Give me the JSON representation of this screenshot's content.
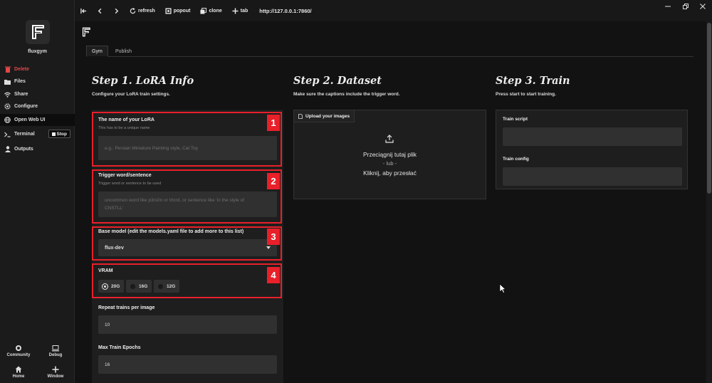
{
  "sidebar": {
    "app_name": "fluxgym",
    "items": [
      {
        "label": "Delete",
        "icon": "trash-icon"
      },
      {
        "label": "Files",
        "icon": "folder-icon"
      },
      {
        "label": "Share",
        "icon": "wifi-icon"
      },
      {
        "label": "Configure",
        "icon": "gear-icon"
      },
      {
        "label": "Open Web UI",
        "icon": "globe-icon"
      },
      {
        "label": "Terminal",
        "icon": "terminal-icon"
      },
      {
        "label": "Outputs",
        "icon": "user-icon"
      }
    ],
    "stop_label": "Stop",
    "bottom": [
      {
        "label": "Community",
        "icon": "community-icon"
      },
      {
        "label": "Debug",
        "icon": "monitor-icon"
      },
      {
        "label": "Home",
        "icon": "home-icon"
      },
      {
        "label": "Window",
        "icon": "plus-icon"
      }
    ]
  },
  "toolbar": {
    "refresh_label": "refresh",
    "popout_label": "popout",
    "clone_label": "clone",
    "tab_label": "tab",
    "url": "http://127.0.0.1:7860/"
  },
  "tabs": [
    {
      "label": "Gym",
      "active": true
    },
    {
      "label": "Publish",
      "active": false
    }
  ],
  "step1": {
    "title": "Step 1. LoRA Info",
    "subtitle": "Configure your LoRA train settings.",
    "lora_name": {
      "label": "The name of your LoRA",
      "hint": "This has to be a unique name",
      "placeholder": "e.g.: Persian Miniature Painting style, Cat Toy"
    },
    "trigger": {
      "label": "Trigger word/sentence",
      "hint": "Trigger word or sentence to be used",
      "placeholder_line1": "uncommon word like p3rs0n or trtcrd, or sentence like 'in the style of",
      "placeholder_line2": "CNSTLL'"
    },
    "base_model": {
      "label": "Base model (edit the models.yaml file to add more to this list)",
      "value": "flux-dev"
    },
    "vram": {
      "label": "VRAM",
      "options": [
        "20G",
        "16G",
        "12G"
      ],
      "selected": "20G"
    },
    "repeat": {
      "label": "Repeat trains per image",
      "value": "10"
    },
    "epochs": {
      "label": "Max Train Epochs",
      "value": "16"
    }
  },
  "step2": {
    "title": "Step 2. Dataset",
    "subtitle": "Make sure the captions include the trigger word.",
    "upload_tab": "Upload your images",
    "drop_line1": "Przeciągnij tutaj plik",
    "drop_line2": "- lub -",
    "drop_line3": "Kliknij, aby przesłać"
  },
  "step3": {
    "title": "Step 3. Train",
    "subtitle": "Press start to start training.",
    "script_label": "Train script",
    "config_label": "Train config"
  },
  "annotations": [
    "1",
    "2",
    "3",
    "4"
  ],
  "colors": {
    "highlight": "#e8202a",
    "background": "#121212",
    "panel": "#1e1e1e",
    "field": "#303030",
    "danger": "#e04848"
  }
}
